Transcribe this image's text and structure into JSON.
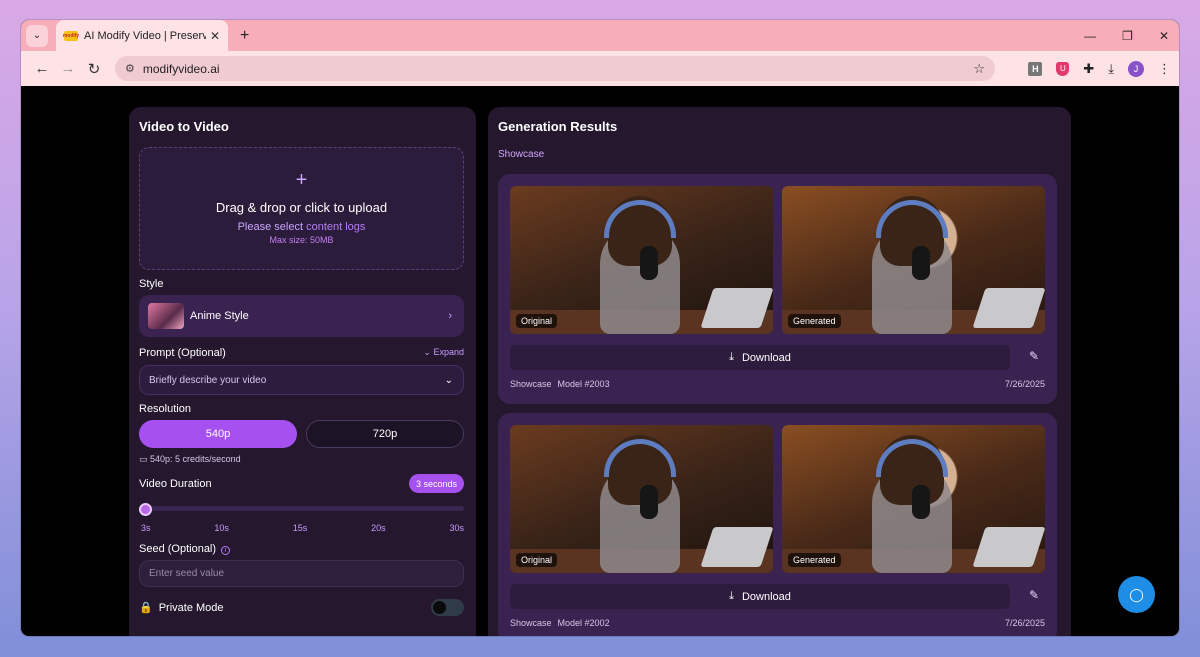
{
  "browser": {
    "tab_title": "AI Modify Video | Preserve Mot",
    "favicon_text": "modify",
    "url": "modifyvideo.ai",
    "avatar_letter": "J",
    "ext_h": "H",
    "ext_shield": "U"
  },
  "left": {
    "title": "Video to Video",
    "upload": {
      "plus": "+",
      "main": "Drag & drop or click to upload",
      "sub_prefix": "Please select ",
      "sub_link": "content logs",
      "max": "Max size: 50MB"
    },
    "style_label": "Style",
    "style_value": "Anime Style",
    "prompt_label": "Prompt (Optional)",
    "expand": "Expand",
    "prompt_placeholder": "Briefly describe your video",
    "resolution_label": "Resolution",
    "res_options": [
      "540p",
      "720p"
    ],
    "credit_text": "540p: 5 credits/second",
    "duration_label": "Video Duration",
    "duration_badge": "3 seconds",
    "duration_value": 3,
    "duration_ticks": [
      "3s",
      "10s",
      "15s",
      "20s",
      "30s"
    ],
    "seed_label": "Seed (Optional)",
    "seed_placeholder": "Enter seed value",
    "private_label": "Private Mode",
    "private_enabled": false
  },
  "right": {
    "title": "Generation Results",
    "tab": "Showcase",
    "download_label": "Download",
    "results": [
      {
        "original_label": "Original",
        "generated_label": "Generated",
        "tag": "Showcase",
        "model": "Model #2003",
        "date": "7/26/2025"
      },
      {
        "original_label": "Original",
        "generated_label": "Generated",
        "tag": "Showcase",
        "model": "Model #2002",
        "date": "7/26/2025"
      }
    ]
  },
  "colors": {
    "accent": "#a650ef",
    "panel_bg": "#24172e",
    "card_bg": "#3a2350",
    "chat_button": "#1e8de6"
  }
}
